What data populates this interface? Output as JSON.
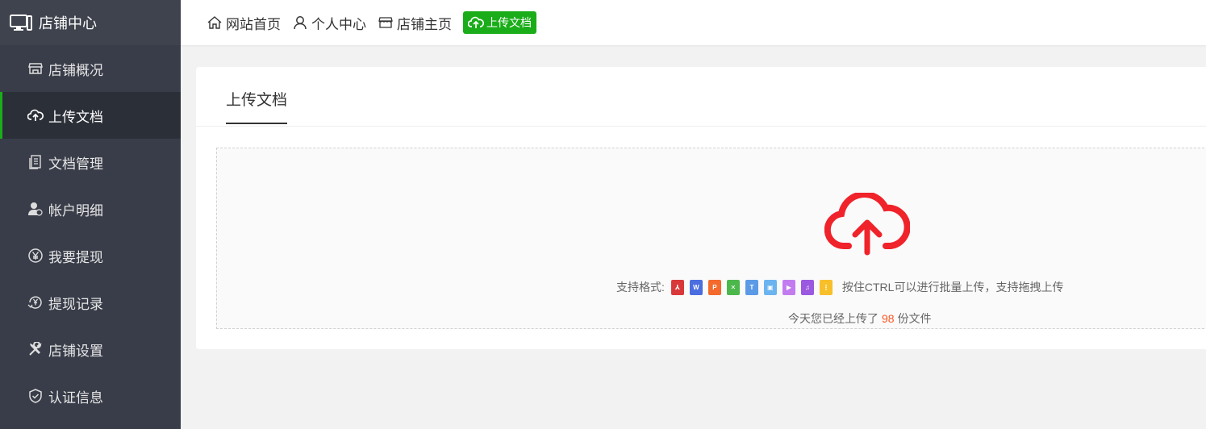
{
  "sidebar": {
    "brand": {
      "title": "店铺中心",
      "icon": "monitor-icon"
    },
    "items": [
      {
        "label": "店铺概况",
        "icon": "store-icon",
        "active": false
      },
      {
        "label": "上传文档",
        "icon": "cloud-upload-icon",
        "active": true
      },
      {
        "label": "文档管理",
        "icon": "document-icon",
        "active": false
      },
      {
        "label": "帐户明细",
        "icon": "user-account-icon",
        "active": false
      },
      {
        "label": "我要提现",
        "icon": "yen-icon",
        "active": false
      },
      {
        "label": "提现记录",
        "icon": "yen-record-icon",
        "active": false
      },
      {
        "label": "店铺设置",
        "icon": "tools-icon",
        "active": false
      },
      {
        "label": "认证信息",
        "icon": "shield-check-icon",
        "active": false
      }
    ]
  },
  "header": {
    "links": [
      {
        "label": "网站首页",
        "icon": "home-icon"
      },
      {
        "label": "个人中心",
        "icon": "user-icon"
      },
      {
        "label": "店铺主页",
        "icon": "store-icon"
      }
    ],
    "upload_button": {
      "label": "上传文档",
      "icon": "cloud-upload-icon"
    }
  },
  "panel": {
    "tab": "上传文档",
    "upload": {
      "formats_label": "支持格式:",
      "formats": [
        {
          "name": "pdf-icon",
          "color": "#d9383a",
          "glyph": "⅄"
        },
        {
          "name": "word-icon",
          "color": "#4a6ee0",
          "glyph": "W"
        },
        {
          "name": "ppt-icon",
          "color": "#f36a2c",
          "glyph": "P"
        },
        {
          "name": "excel-icon",
          "color": "#4cb84c",
          "glyph": "✕"
        },
        {
          "name": "txt-icon",
          "color": "#5a9ae6",
          "glyph": "T"
        },
        {
          "name": "image-icon",
          "color": "#6cb4f0",
          "glyph": "▣"
        },
        {
          "name": "video-icon",
          "color": "#c27cf0",
          "glyph": "▶"
        },
        {
          "name": "audio-icon",
          "color": "#9b59e0",
          "glyph": "♫"
        },
        {
          "name": "zip-icon",
          "color": "#f7c02a",
          "glyph": "⋮"
        }
      ],
      "tip": "按住CTRL可以进行批量上传，支持拖拽上传",
      "count_prefix": "今天您已经上传了",
      "count": "98",
      "count_suffix": "份文件"
    },
    "accent_color": "#f0222a"
  },
  "colors": {
    "sidebar_bg": "#393d49",
    "active_bar": "#1aad19",
    "button_bg": "#1aad19",
    "count_color": "#ff5722"
  }
}
